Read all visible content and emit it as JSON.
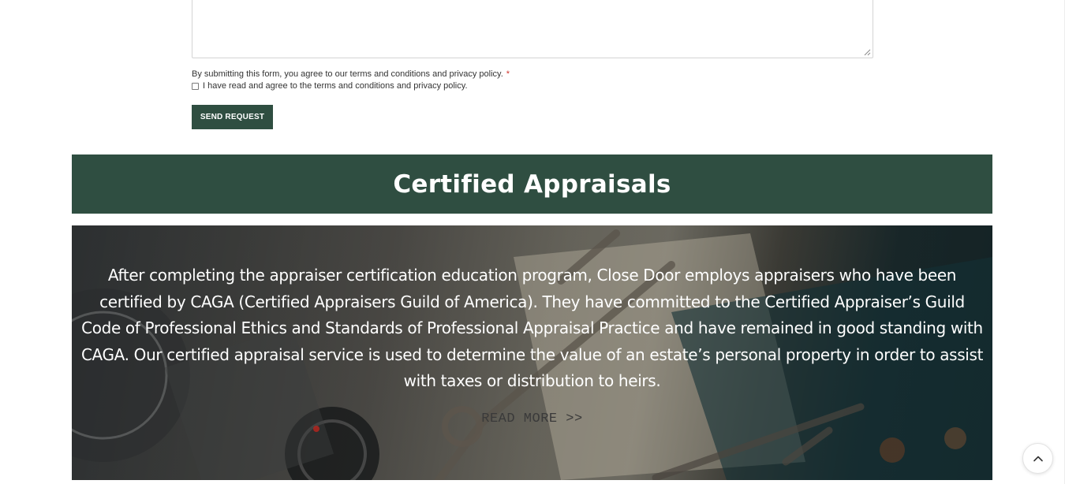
{
  "form": {
    "consent_text": "By submitting this form, you agree to our terms and conditions and privacy policy.",
    "required_marker": "*",
    "checkbox_label": "I have read and agree to the terms and conditions and privacy policy.",
    "checkbox_checked": false,
    "submit_label": "SEND REQUEST"
  },
  "section": {
    "title": "Certified Appraisals",
    "body": "After completing the appraiser certification education program, Close Door employs appraisers who have been certified by CAGA (Certified Appraisers Guild of America). They have committed to the Certified Appraiser’s Guild Code of Professional Ethics and Standards of Professional Appraisal Practice and have remained in good standing with CAGA. Our certified appraisal service is used to determine the value of an estate’s personal property in order to assist with taxes or distribution to heirs.",
    "read_more": "READ MORE >>"
  },
  "icons": {
    "scroll_top": "chevron-up-icon",
    "resize": "resize-grip-icon"
  },
  "colors": {
    "brand_green": "#2f4e41",
    "required": "#d0342c"
  }
}
